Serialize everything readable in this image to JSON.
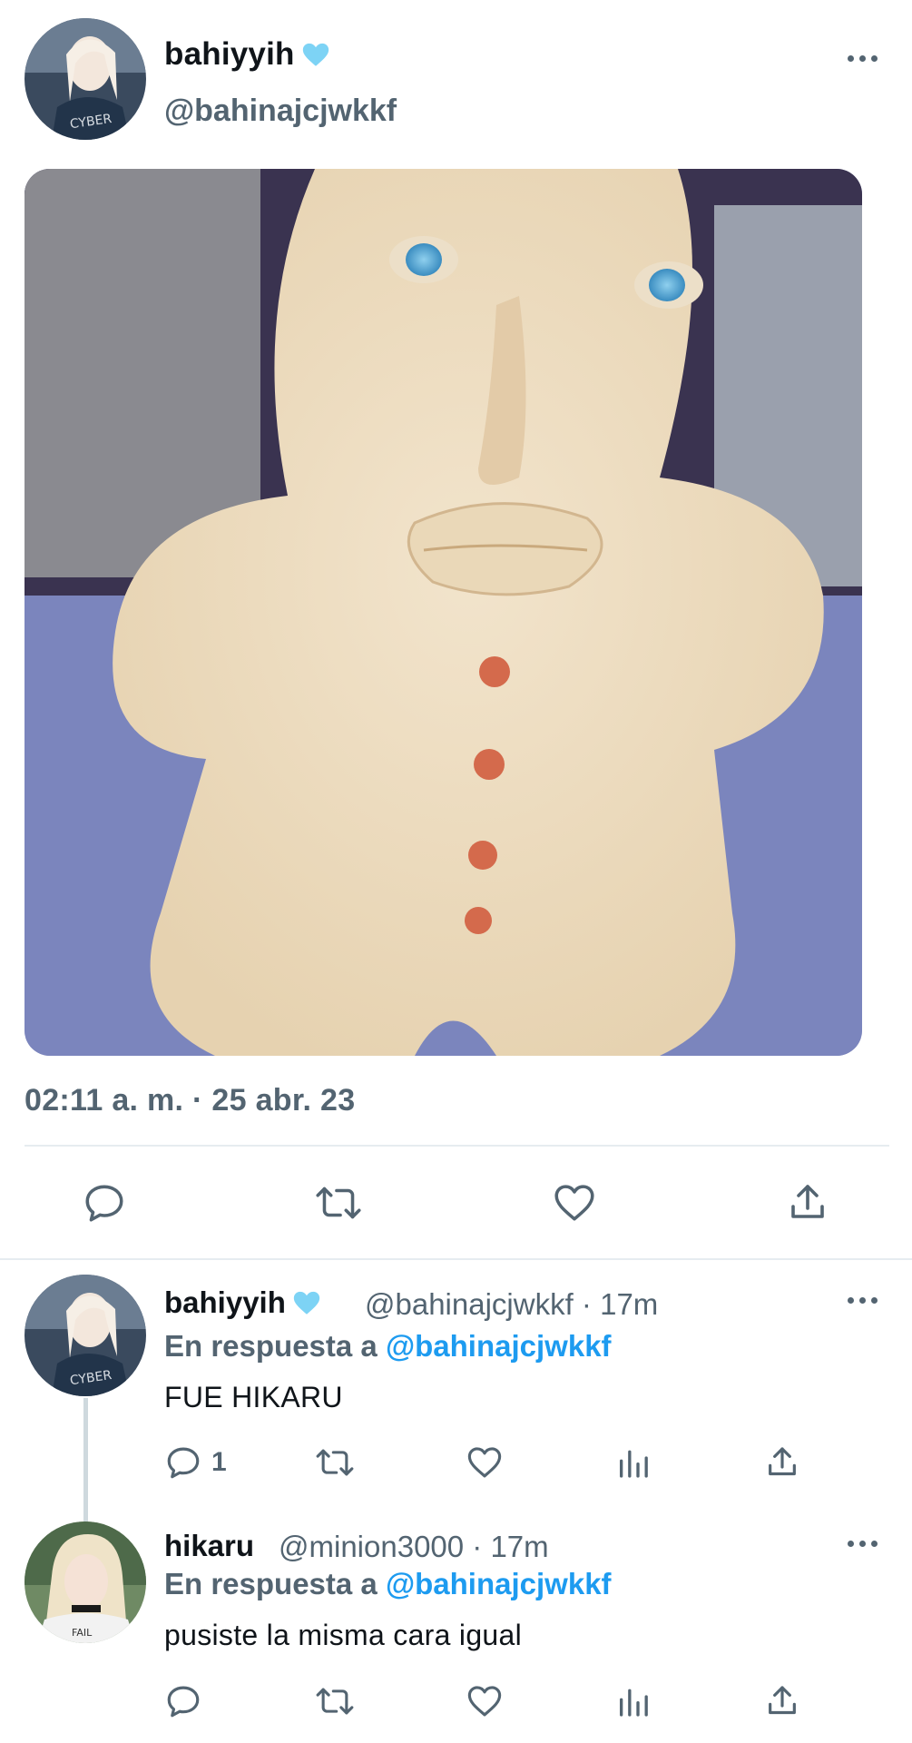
{
  "main_tweet": {
    "author_name": "bahiyyih",
    "verified_icon": "light-blue-heart",
    "author_handle": "@bahinajcjwkkf",
    "timestamp": "02:11 a. m. · 25 abr. 23",
    "actions": [
      "reply-icon",
      "retweet-icon",
      "like-icon",
      "share-icon"
    ]
  },
  "replies": [
    {
      "author_name": "bahiyyih",
      "verified_icon": "light-blue-heart",
      "meta": "@bahinajcjwkkf · 17m",
      "replying_prefix": "En respuesta a ",
      "replying_mention": "@bahinajcjwkkf",
      "text": "FUE HIKARU",
      "reply_count": "1"
    },
    {
      "author_name": "hikaru",
      "meta": "@minion3000 · 17m",
      "replying_prefix": "En respuesta a ",
      "replying_mention": "@bahinajcjwkkf",
      "text": "pusiste la misma cara igual"
    }
  ],
  "colors": {
    "text_primary": "#0f1419",
    "text_secondary": "#536471",
    "link": "#1d9bf0",
    "divider": "#e6ecf0",
    "heart_badge": "#7dd3f5"
  }
}
